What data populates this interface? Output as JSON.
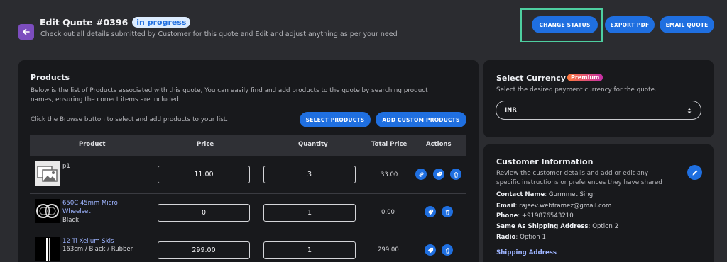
{
  "header": {
    "title": "Edit Quote #0396",
    "status_badge": "in progress",
    "subtitle": "Check out all details submitted by Customer for this quote and Edit and adjust anything as per your need"
  },
  "toolbar": {
    "change_status": "CHANGE STATUS",
    "export_pdf": "EXPORT PDF",
    "email_quote": "EMAIL QUOTE"
  },
  "products": {
    "title": "Products",
    "desc_line1": "Below is the list of Products associated with this quote, You can easily find and add products to the quote by searching product",
    "desc_line2": "names, ensuring the correct items are included.",
    "browse_hint": "Click the Browse button to select and add products to your list.",
    "select_btn": "SELECT PRODUCTS",
    "custom_btn": "ADD CUSTOM PRODUCTS",
    "columns": [
      "Product",
      "Price",
      "Quantity",
      "Total Price",
      "Actions"
    ],
    "rows": [
      {
        "name": "p1",
        "variant": "",
        "price": "11.00",
        "qty": "3",
        "total": "33.00"
      },
      {
        "name_line1": "650C 45mm Micro",
        "name_line2": "Wheelset",
        "variant": "Black",
        "price": "0",
        "qty": "1",
        "total": "0.00"
      },
      {
        "name": "12 Ti Xelium Skis",
        "variant": "163cm / Black / Rubber",
        "price": "299.00",
        "qty": "1",
        "total": "299.00"
      }
    ]
  },
  "currency": {
    "title": "Select Currency",
    "badge": "Premium",
    "desc": "Select the desired payment currency for the quote.",
    "selected": "INR"
  },
  "customer": {
    "title": "Customer Information",
    "desc_line1": "Review the customer details and add or edit any",
    "desc_line2": "specific instructions or preferences they have shared",
    "contact_label": "Contact Name",
    "contact_value": "Gurmmet Singh",
    "email_label": "Email",
    "email_value": "rajeev.webframez@gmail.com",
    "phone_label": "Phone",
    "phone_value": "+919876543210",
    "same_label": "Same As Shipping Address",
    "same_value": "Option 2",
    "radio_label": "Radio",
    "radio_value": "Option 1",
    "shipping_title": "Shipping Address"
  },
  "colors": {
    "accent": "#1f6fe0",
    "background": "#2b2c30",
    "card": "#18191c",
    "focus": "#4ecfa0",
    "back_button": "#7c4dbe"
  },
  "icons": [
    "back-arrow-icon",
    "image-placeholder-icon",
    "link-icon",
    "discount-icon",
    "trash-icon",
    "pencil-icon",
    "select-arrows-icon"
  ]
}
